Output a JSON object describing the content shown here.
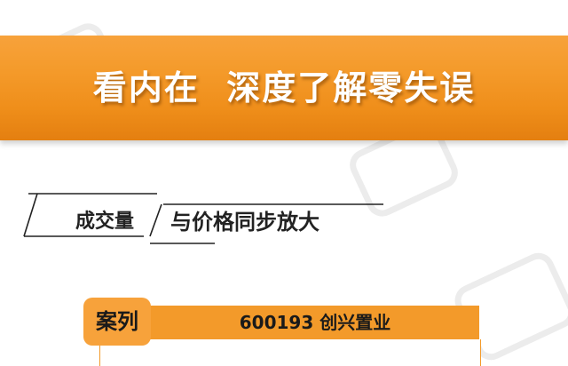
{
  "banner": {
    "title": "看内在  深度了解零失误",
    "color": "#f39a2a"
  },
  "section": {
    "tag": "成交量",
    "text": "与价格同步放大"
  },
  "case": {
    "label": "案列",
    "title": "600193 创兴置业",
    "color": "#f39a2a"
  }
}
